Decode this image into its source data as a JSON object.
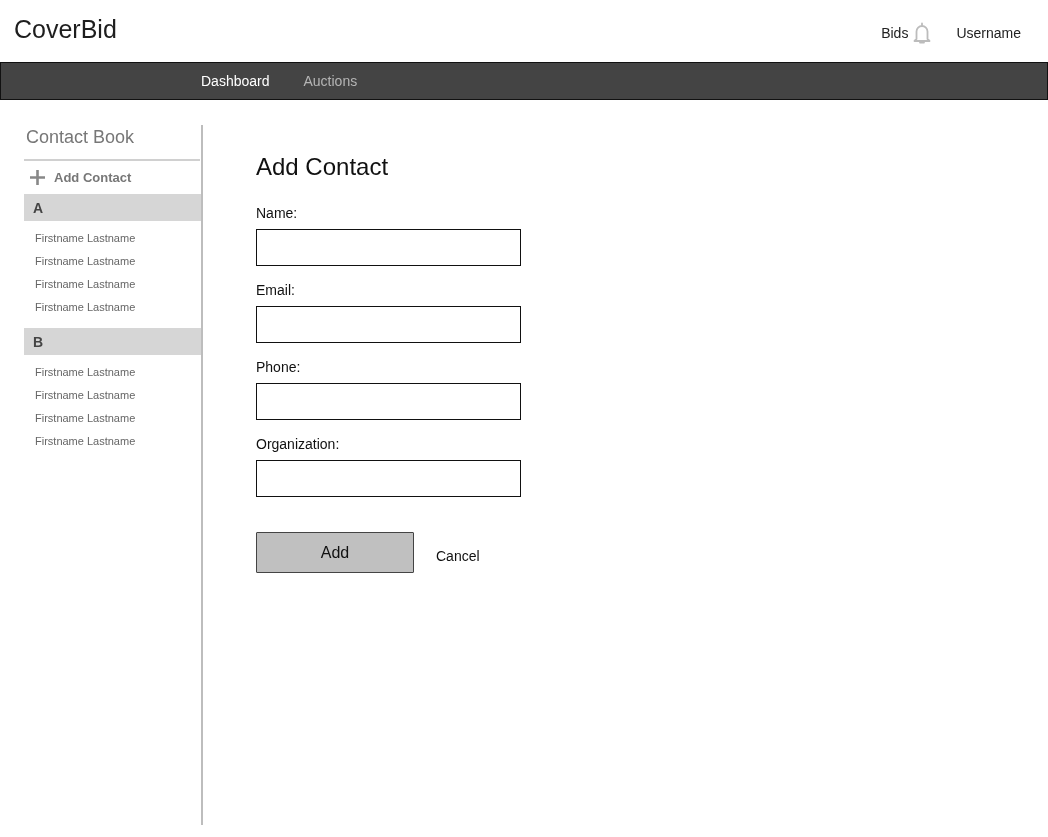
{
  "header": {
    "logo": "CoverBid",
    "bids_link": "Bids",
    "user_menu": "Username"
  },
  "nav": {
    "items": [
      {
        "label": "Dashboard",
        "selected": true
      },
      {
        "label": "Auctions",
        "selected": false
      }
    ]
  },
  "sidebar": {
    "title": "Contact Book",
    "add_contact": "Add Contact",
    "groups": [
      {
        "letter": "A",
        "contacts": [
          "Firstname Lastname",
          "Firstname Lastname",
          "Firstname Lastname",
          "Firstname Lastname"
        ]
      },
      {
        "letter": "B",
        "contacts": [
          "Firstname Lastname",
          "Firstname Lastname",
          "Firstname Lastname",
          "Firstname Lastname"
        ]
      }
    ]
  },
  "form": {
    "title": "Add Contact",
    "fields": [
      {
        "label": "Name:"
      },
      {
        "label": "Email:"
      },
      {
        "label": "Phone:"
      },
      {
        "label": "Organization:"
      }
    ],
    "submit_button": "Add",
    "cancel_link": "Cancel"
  }
}
